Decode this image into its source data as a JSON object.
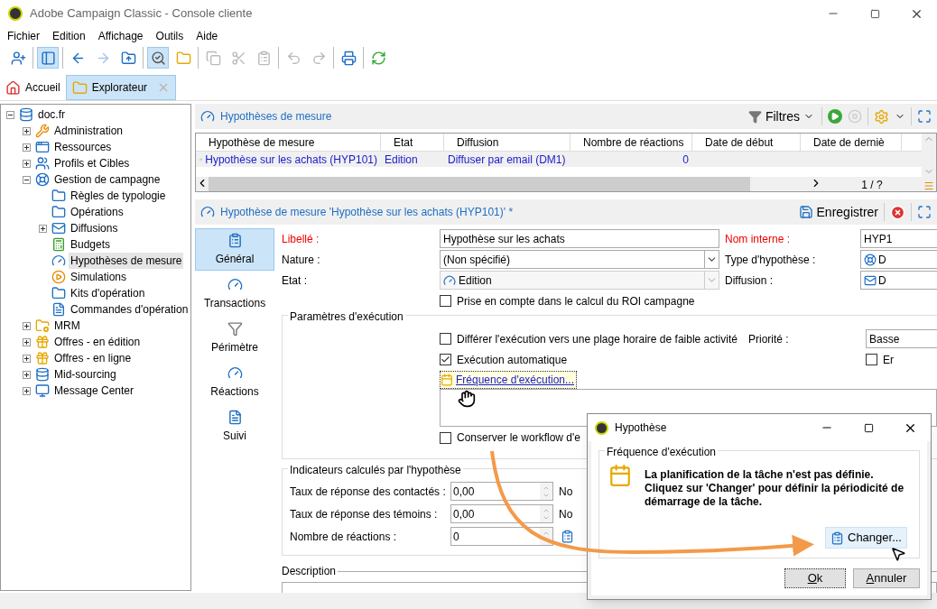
{
  "window": {
    "title": "Adobe Campaign Classic - Console cliente"
  },
  "menu": [
    "Fichier",
    "Edition",
    "Affichage",
    "Outils",
    "Aide"
  ],
  "toolbar": [
    [
      {
        "kind": "user",
        "selected": false,
        "disabled": false
      }
    ],
    [
      {
        "kind": "panel",
        "selected": true,
        "disabled": false
      }
    ],
    [
      {
        "kind": "back",
        "selected": false,
        "disabled": false
      },
      {
        "kind": "forward",
        "selected": false,
        "disabled": true
      },
      {
        "kind": "folder-up",
        "selected": false,
        "disabled": false
      }
    ],
    [
      {
        "kind": "search",
        "selected": true,
        "disabled": false
      },
      {
        "kind": "folder",
        "selected": false,
        "disabled": false
      }
    ],
    [
      {
        "kind": "copy",
        "selected": false,
        "disabled": true
      },
      {
        "kind": "cut",
        "selected": false,
        "disabled": true
      },
      {
        "kind": "paste",
        "selected": false,
        "disabled": true
      }
    ],
    [
      {
        "kind": "undo",
        "selected": false,
        "disabled": true
      },
      {
        "kind": "redo",
        "selected": false,
        "disabled": true
      }
    ],
    [
      {
        "kind": "print",
        "selected": false,
        "disabled": false
      }
    ],
    [
      {
        "kind": "refresh",
        "selected": false,
        "disabled": false
      }
    ]
  ],
  "tabs": [
    {
      "label": "Accueil",
      "kind": "home",
      "selected": false,
      "closable": false
    },
    {
      "label": "Explorateur",
      "kind": "folder",
      "selected": true,
      "closable": true
    }
  ],
  "tree": {
    "label": "doc.fr",
    "kind": "database",
    "selected": false,
    "expanded": true,
    "children": [
      {
        "label": "Administration",
        "kind": "wrench",
        "selected": false,
        "expanded": false
      },
      {
        "label": "Ressources",
        "kind": "window",
        "selected": false,
        "expanded": false
      },
      {
        "label": "Profils et Cibles",
        "kind": "users",
        "selected": false,
        "expanded": false
      },
      {
        "label": "Gestion de campagne",
        "kind": "lifebuoy",
        "selected": false,
        "expanded": true,
        "children": [
          {
            "label": "Règles de typologie",
            "kind": "folder",
            "selected": false
          },
          {
            "label": "Opérations",
            "kind": "folder-mail",
            "selected": false
          },
          {
            "label": "Diffusions",
            "kind": "mail",
            "selected": false,
            "expanded": false
          },
          {
            "label": "Budgets",
            "kind": "calculator",
            "selected": false
          },
          {
            "label": "Hypothèses de mesure",
            "kind": "gauge",
            "selected": true
          },
          {
            "label": "Simulations",
            "kind": "play",
            "selected": false
          },
          {
            "label": "Kits d'opération",
            "kind": "folder",
            "selected": false
          },
          {
            "label": "Commandes d'opération",
            "kind": "document",
            "selected": false
          }
        ]
      },
      {
        "label": "MRM",
        "kind": "folder-gear",
        "selected": false,
        "expanded": false
      },
      {
        "label": "Offres - en édition",
        "kind": "gift",
        "selected": false,
        "expanded": false
      },
      {
        "label": "Offres - en ligne",
        "kind": "gift",
        "selected": false,
        "expanded": false
      },
      {
        "label": "Mid-sourcing",
        "kind": "database",
        "selected": false,
        "expanded": false
      },
      {
        "label": "Message Center",
        "kind": "monitor",
        "selected": false,
        "expanded": false
      }
    ]
  },
  "list": {
    "title": "Hypothèses de mesure",
    "filter_label": "Filtres",
    "columns": [
      "Hypothèse de mesure",
      "Etat",
      "Diffusion",
      "Nombre de réactions",
      "Date de début",
      "Date de derniè"
    ],
    "rows": [
      {
        "cells": [
          "Hypothèse sur les achats (HYP101)",
          "Edition",
          "Diffuser par email (DM1)",
          "0",
          "",
          ""
        ],
        "selected": true
      }
    ],
    "pager": "1 / ?"
  },
  "detail": {
    "title": "Hypothèse de mesure 'Hypothèse sur les achats (HYP101)' *",
    "save_label": "Enregistrer",
    "side_tabs": [
      {
        "label": "Général",
        "kind": "clipboard",
        "selected": true
      },
      {
        "label": "Transactions",
        "kind": "gauge",
        "selected": false
      },
      {
        "label": "Périmètre",
        "kind": "funnel",
        "selected": false
      },
      {
        "label": "Réactions",
        "kind": "gauge",
        "selected": false
      },
      {
        "label": "Suivi",
        "kind": "document",
        "selected": false
      }
    ],
    "fields": [
      {
        "label": "Libellé :",
        "required": true,
        "kind": "text",
        "value": "Hypothèse sur les achats",
        "disabled": false,
        "right": {
          "label": "Nom interne :",
          "required": true,
          "value": "HYP1",
          "kind": "text"
        }
      },
      {
        "label": "Nature :",
        "required": false,
        "kind": "select",
        "value": "(Non spécifié)",
        "disabled": false,
        "right": {
          "label": "Type d'hypothèse :",
          "required": false,
          "value": "D",
          "kind": "lifebuoy"
        }
      },
      {
        "label": "Etat :",
        "required": false,
        "kind": "select",
        "value": "Edition",
        "disabled": true,
        "right": {
          "label": "Diffusion :",
          "required": false,
          "value": "D",
          "kind": "mail"
        }
      }
    ],
    "roi_checkbox": {
      "label": "Prise en compte dans le calcul du ROI campagne",
      "checked": false
    },
    "execution": {
      "title": "Paramètres d'exécution",
      "defer": {
        "label": "Différer l'exécution vers une plage horaire de faible activité",
        "checked": false
      },
      "priority_label": "Priorité :",
      "priority_value": "Basse",
      "auto": {
        "label": "Exécution automatique",
        "checked": true
      },
      "right_checkbox": {
        "label": "Er",
        "checked": false
      },
      "frequency_link": "Fréquence d'exécution...",
      "keep_workflow": {
        "label": "Conserver le workflow d'e",
        "checked": false
      }
    },
    "indicators": {
      "title": "Indicateurs calculés par l'hypothèse",
      "rows": [
        {
          "label": "Taux de réponse des contactés :",
          "value": "0,00",
          "right_label": "No"
        },
        {
          "label": "Taux de réponse des témoins :",
          "value": "0,00",
          "right_label": "No"
        },
        {
          "label": "Nombre de réactions :",
          "value": "0",
          "right_label": ""
        }
      ]
    },
    "description_title": "Description"
  },
  "dialog": {
    "title": "Hypothèse",
    "group_title": "Fréquence d'exécution",
    "message": [
      "La planification de la tâche n'est pas définie.",
      "Cliquez sur 'Changer' pour définir la périodicité de",
      "démarrage de la tâche."
    ],
    "change_label": "Changer...",
    "ok_label": "Ok",
    "cancel_label": "Annuler"
  }
}
